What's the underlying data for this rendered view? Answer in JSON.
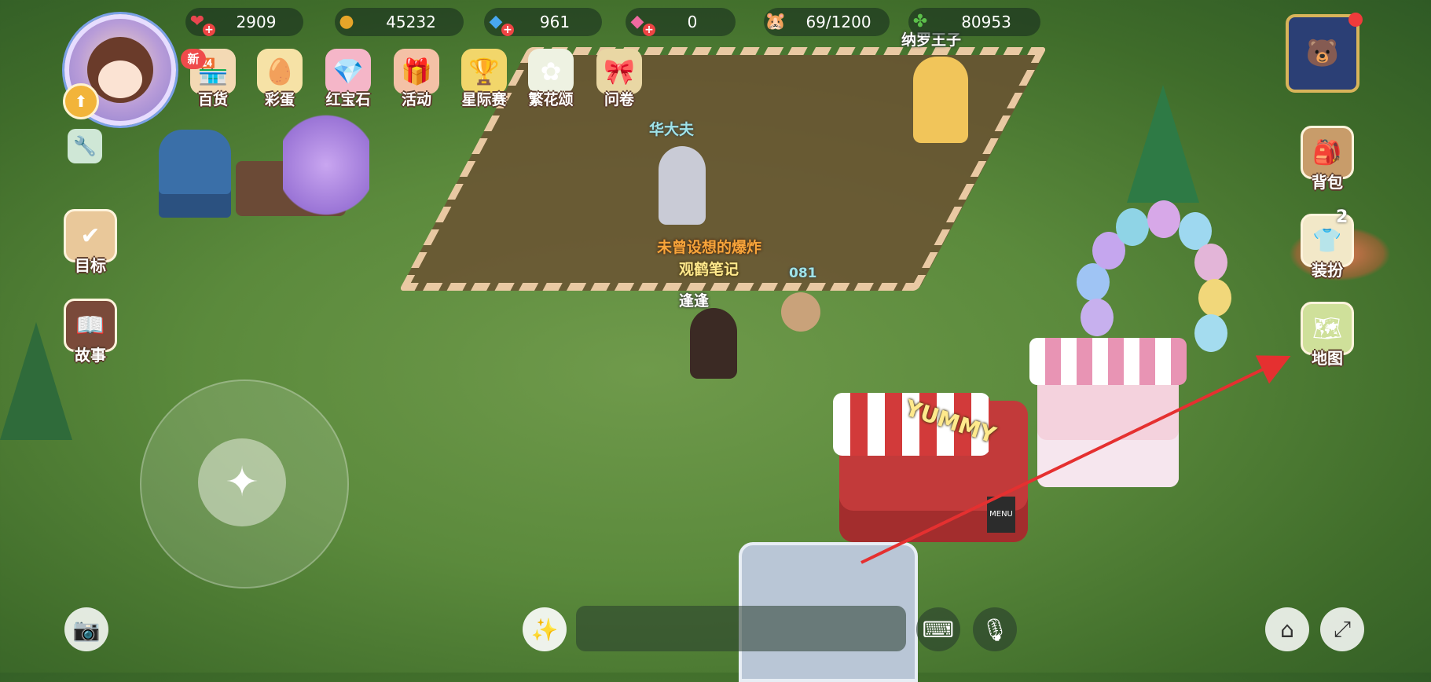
{
  "resources": [
    {
      "id": "hearts",
      "icon": "heart-icon",
      "value": "2909",
      "color": "#e8464f",
      "has_plus": true
    },
    {
      "id": "coins",
      "icon": "coin-icon",
      "value": "45232",
      "color": "#e6a529",
      "has_plus": false
    },
    {
      "id": "diamonds",
      "icon": "blue-diamond-icon",
      "value": "961",
      "color": "#48a8f0",
      "has_plus": true
    },
    {
      "id": "rubies",
      "icon": "pink-gem-icon",
      "value": "0",
      "color": "#f06aa0",
      "has_plus": true
    },
    {
      "id": "hamster",
      "icon": "hamster-icon",
      "value": "69/1200",
      "color": "#f2c99a",
      "has_plus": false
    },
    {
      "id": "clover",
      "icon": "clover-icon",
      "value": "80953",
      "color": "#5bbf4a",
      "has_plus": false
    }
  ],
  "top_menu": [
    {
      "id": "department-store",
      "icon": "shop-icon",
      "label": "百货",
      "badge": "新"
    },
    {
      "id": "easter-egg",
      "icon": "egg-icon",
      "label": "彩蛋"
    },
    {
      "id": "ruby",
      "icon": "ruby-icon",
      "label": "红宝石"
    },
    {
      "id": "events",
      "icon": "gift-icon",
      "label": "活动"
    },
    {
      "id": "interstellar-race",
      "icon": "trophy-icon",
      "label": "星际赛"
    },
    {
      "id": "flower-ode",
      "icon": "flower-icon",
      "label": "繁花颂"
    },
    {
      "id": "questionnaire",
      "icon": "present-icon",
      "label": "问卷"
    }
  ],
  "left_side": [
    {
      "id": "goals",
      "icon": "calendar-check-icon",
      "label": "目标"
    },
    {
      "id": "story",
      "icon": "book-icon",
      "label": "故事"
    }
  ],
  "right_side": [
    {
      "id": "backpack",
      "icon": "backpack-icon",
      "label": "背包"
    },
    {
      "id": "dress-up",
      "icon": "shirt-icon",
      "label": "装扮",
      "count": "2"
    },
    {
      "id": "map",
      "icon": "map-icon",
      "label": "地图"
    }
  ],
  "name_tags": {
    "prince": "纳罗王子",
    "huadafu": "华大夫",
    "title_orange": "未曾设想的爆炸",
    "guild": "观鹤笔记",
    "player": "逢逢",
    "pet_number": "081"
  },
  "bottom_bar": {
    "chat_placeholder": ""
  },
  "scene_text": {
    "truck_sign": "YUMMY",
    "menu_board": "MENU"
  },
  "colors": {
    "grass": "#5b8a3c",
    "arrow": "#e53030",
    "label_outline": "#5a3a2a"
  }
}
